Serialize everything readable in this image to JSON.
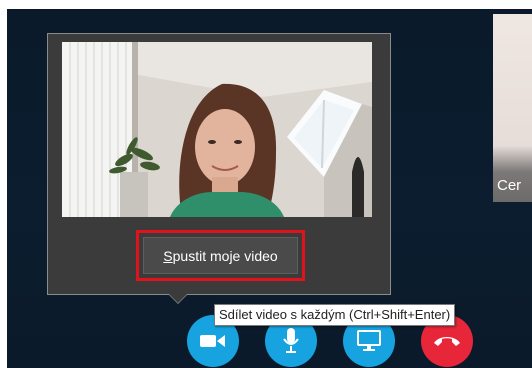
{
  "remote": {
    "label": "Cer"
  },
  "preview": {
    "start_video_label_accel": "S",
    "start_video_label_rest": "pustit moje video"
  },
  "tooltip": {
    "text": "Sdílet video s každým (Ctrl+Shift+Enter)"
  },
  "controls": [
    {
      "icon": "video-camera-icon",
      "color": "#16a3e0"
    },
    {
      "icon": "microphone-icon",
      "color": "#16a3e0"
    },
    {
      "icon": "screen-share-icon",
      "color": "#16a3e0"
    },
    {
      "icon": "hang-up-icon",
      "color": "#e8263a"
    }
  ],
  "colors": {
    "background": "#0b1d2f",
    "popup": "#3b3b3b",
    "highlight": "#e0121b",
    "accent": "#16a3e0",
    "end_call": "#e8263a"
  }
}
